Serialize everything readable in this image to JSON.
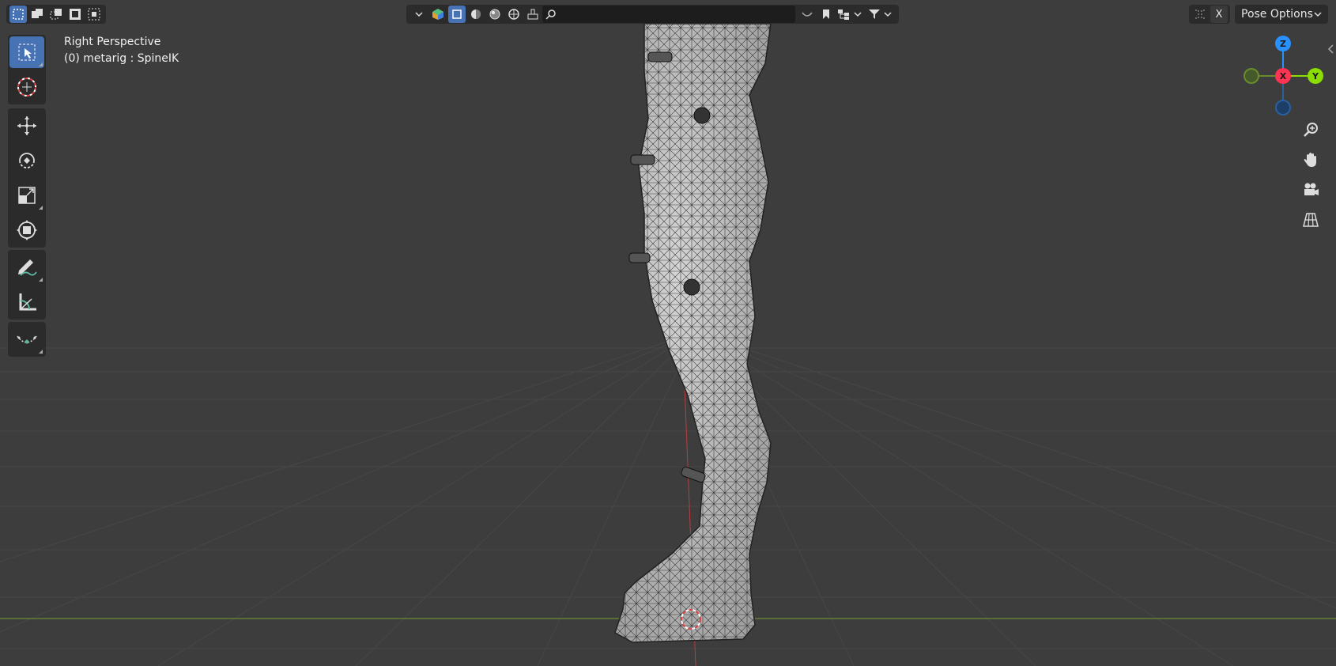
{
  "viewport": {
    "view_name": "Right Perspective",
    "object_info": "(0) metarig : SpineIK"
  },
  "header": {
    "select_modes": [
      "select-box-new",
      "select-box-extend",
      "select-box-subtract",
      "select-box-invert",
      "select-box-intersect"
    ],
    "search_placeholder": "",
    "pose_options_label": "Pose Options",
    "x_label": "X"
  },
  "toolbar": {
    "tools": [
      "select-box",
      "cursor",
      "move",
      "rotate",
      "scale",
      "transform",
      "annotate",
      "measure",
      "bone-relax"
    ]
  },
  "gizmo": {
    "z_label": "Z",
    "x_label": "X",
    "y_label": "Y",
    "colors": {
      "x": "#ff3352",
      "y": "#8bdc00",
      "z": "#2890ff"
    }
  },
  "colors": {
    "background": "#3d3d3d",
    "grid": "#4a4a4a",
    "panel": "#2b2b2b",
    "accent": "#4772b3",
    "floor_line": "#6a8a3a",
    "z_axis_line": "#b44040"
  }
}
